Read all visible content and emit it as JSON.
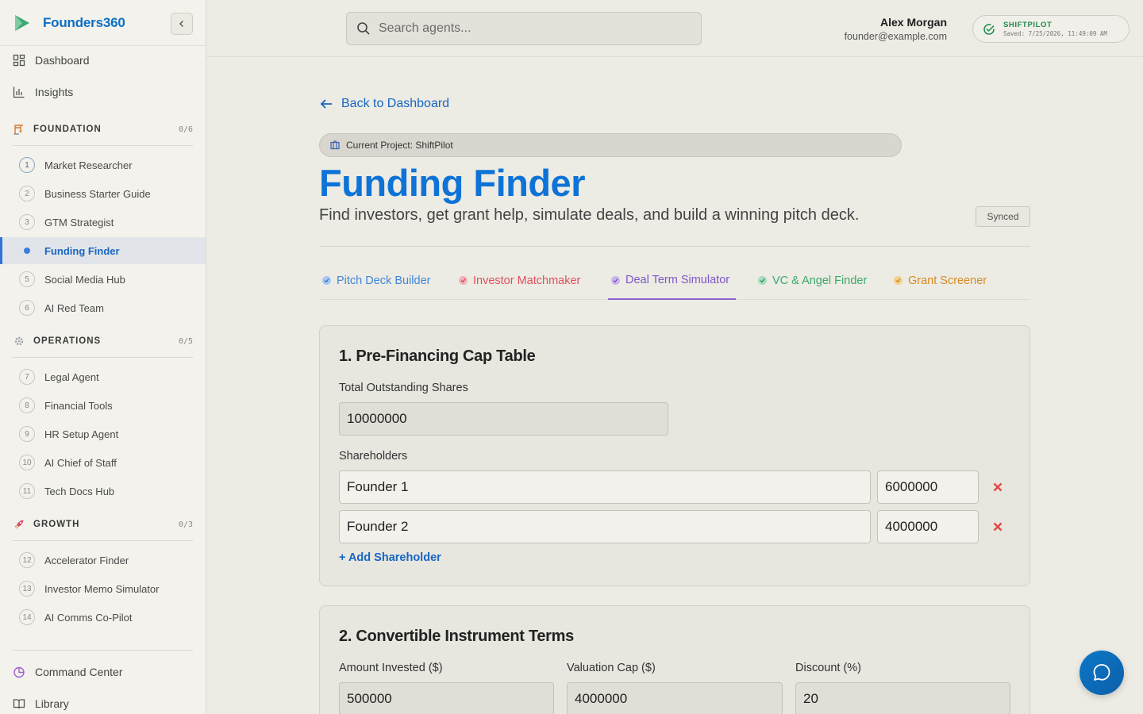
{
  "brand": {
    "name": "Founders360"
  },
  "nav": {
    "dashboard": "Dashboard",
    "insights": "Insights",
    "command_center": "Command Center",
    "library": "Library"
  },
  "sections": {
    "foundation": {
      "title": "FOUNDATION",
      "count": "0/6"
    },
    "operations": {
      "title": "OPERATIONS",
      "count": "0/5"
    },
    "growth": {
      "title": "GROWTH",
      "count": "0/3"
    }
  },
  "agents": [
    {
      "num": "1",
      "label": "Market Researcher"
    },
    {
      "num": "2",
      "label": "Business Starter Guide"
    },
    {
      "num": "3",
      "label": "GTM Strategist"
    },
    {
      "num": "4",
      "label": "Funding Finder"
    },
    {
      "num": "5",
      "label": "Social Media Hub"
    },
    {
      "num": "6",
      "label": "AI Red Team"
    },
    {
      "num": "7",
      "label": "Legal Agent"
    },
    {
      "num": "8",
      "label": "Financial Tools"
    },
    {
      "num": "9",
      "label": "HR Setup Agent"
    },
    {
      "num": "10",
      "label": "AI Chief of Staff"
    },
    {
      "num": "11",
      "label": "Tech Docs Hub"
    },
    {
      "num": "12",
      "label": "Accelerator Finder"
    },
    {
      "num": "13",
      "label": "Investor Memo Simulator"
    },
    {
      "num": "14",
      "label": "AI Comms Co-Pilot"
    }
  ],
  "search": {
    "placeholder": "Search agents..."
  },
  "user": {
    "name": "Alex Morgan",
    "email": "founder@example.com"
  },
  "save_status": {
    "title": "SHIFTPILOT",
    "subtitle": "Saved: 7/25/2026, 11:49:09 AM"
  },
  "page": {
    "back_label": "Back to Dashboard",
    "project_label": "Current Project: ShiftPilot",
    "title": "Funding Finder",
    "subtitle": "Find investors, get grant help, simulate deals, and build a winning pitch deck.",
    "sync_badge": "Synced"
  },
  "tabs": [
    {
      "label": "Pitch Deck Builder",
      "color": "#4f8fe0"
    },
    {
      "label": "Investor Matchmaker",
      "color": "#e0505a"
    },
    {
      "label": "Deal Term Simulator",
      "color": "#8a63d2"
    },
    {
      "label": "VC & Angel Finder",
      "color": "#3ba86a"
    },
    {
      "label": "Grant Screener",
      "color": "#e0922a"
    }
  ],
  "cap_table": {
    "title": "1. Pre-Financing Cap Table",
    "total_label": "Total Outstanding Shares",
    "total_value": "10000000",
    "shareholders_label": "Shareholders",
    "shareholders": [
      {
        "name": "Founder 1",
        "shares": "6000000"
      },
      {
        "name": "Founder 2",
        "shares": "4000000"
      }
    ],
    "add_label": "+ Add Shareholder"
  },
  "convertible": {
    "title": "2. Convertible Instrument Terms",
    "amount_label": "Amount Invested ($)",
    "amount_value": "500000",
    "cap_label": "Valuation Cap ($)",
    "cap_value": "4000000",
    "discount_label": "Discount (%)",
    "discount_value": "20"
  },
  "colors": {
    "brand": "#0b6fc4",
    "title": "#0d73d6",
    "link": "#1766c4",
    "danger": "#e04848",
    "active_tab": "#8a63d2"
  }
}
